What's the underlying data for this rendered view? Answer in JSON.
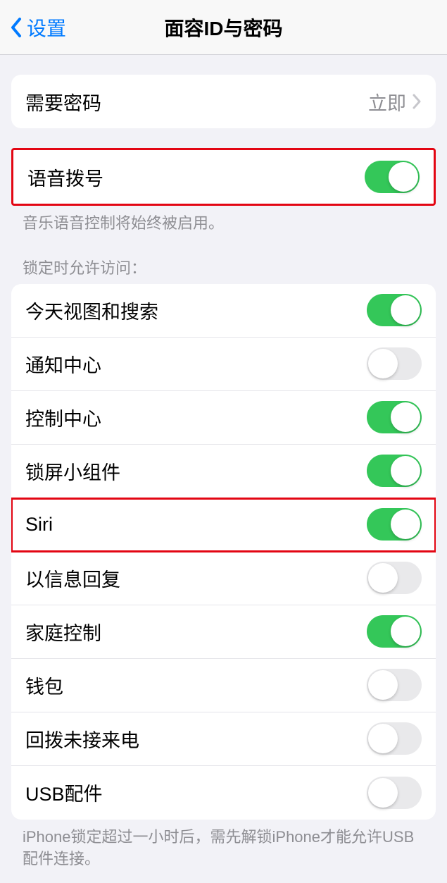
{
  "header": {
    "back_label": "设置",
    "title": "面容ID与密码"
  },
  "require_passcode": {
    "label": "需要密码",
    "value": "立即"
  },
  "voice_dial": {
    "label": "语音拨号",
    "on": true,
    "footer": "音乐语音控制将始终被启用。"
  },
  "lock_access": {
    "header": "锁定时允许访问：",
    "items": [
      {
        "label": "今天视图和搜索",
        "on": true,
        "highlighted": false
      },
      {
        "label": "通知中心",
        "on": false,
        "highlighted": false
      },
      {
        "label": "控制中心",
        "on": true,
        "highlighted": false
      },
      {
        "label": "锁屏小组件",
        "on": true,
        "highlighted": false
      },
      {
        "label": "Siri",
        "on": true,
        "highlighted": true
      },
      {
        "label": "以信息回复",
        "on": false,
        "highlighted": false
      },
      {
        "label": "家庭控制",
        "on": true,
        "highlighted": false
      },
      {
        "label": "钱包",
        "on": false,
        "highlighted": false
      },
      {
        "label": "回拨未接来电",
        "on": false,
        "highlighted": false
      },
      {
        "label": "USB配件",
        "on": false,
        "highlighted": false
      }
    ],
    "footer": "iPhone锁定超过一小时后，需先解锁iPhone才能允许USB配件连接。"
  }
}
